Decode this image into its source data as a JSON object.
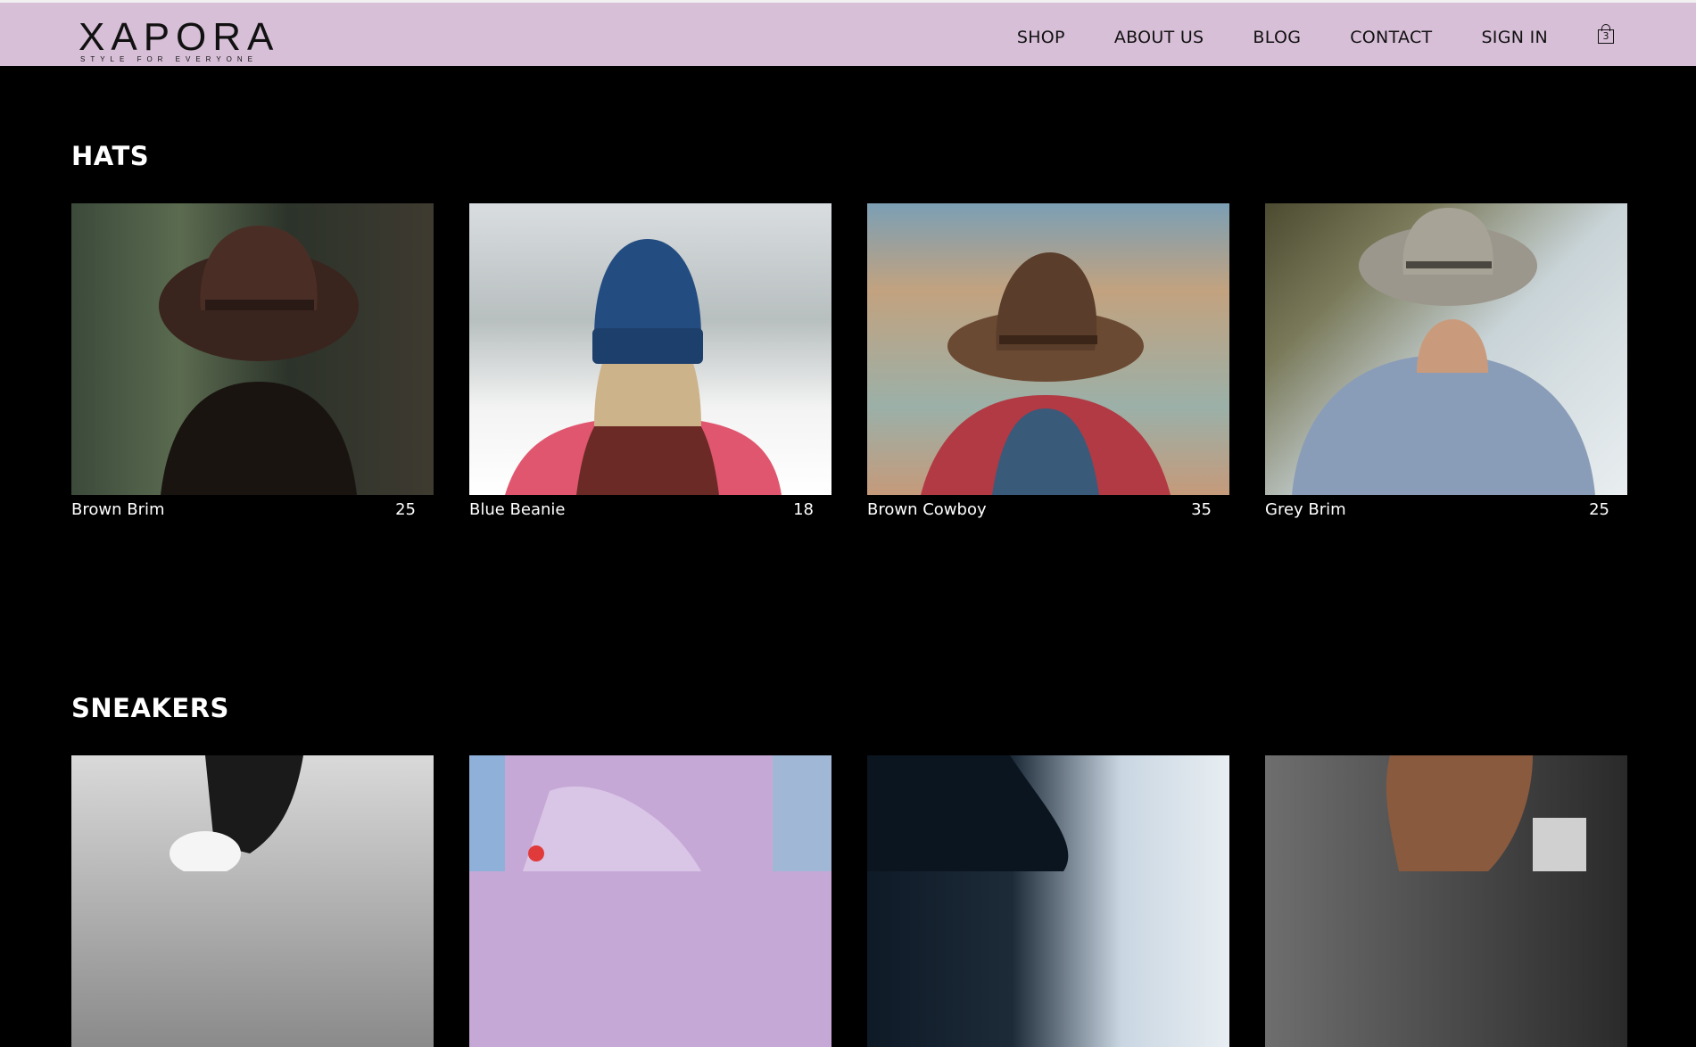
{
  "header": {
    "logo": "XAPORA",
    "tagline": "STYLE FOR EVERYONE",
    "nav": [
      "SHOP",
      "ABOUT US",
      "BLOG",
      "CONTACT",
      "SIGN IN"
    ],
    "cart_count": "3"
  },
  "sections": [
    {
      "title": "HATS",
      "products": [
        {
          "name": "Brown Brim",
          "price": "25"
        },
        {
          "name": "Blue Beanie",
          "price": "18"
        },
        {
          "name": "Brown Cowboy",
          "price": "35"
        },
        {
          "name": "Grey Brim",
          "price": "25"
        }
      ]
    },
    {
      "title": "SNEAKERS",
      "products": [
        {},
        {},
        {},
        {}
      ]
    }
  ]
}
